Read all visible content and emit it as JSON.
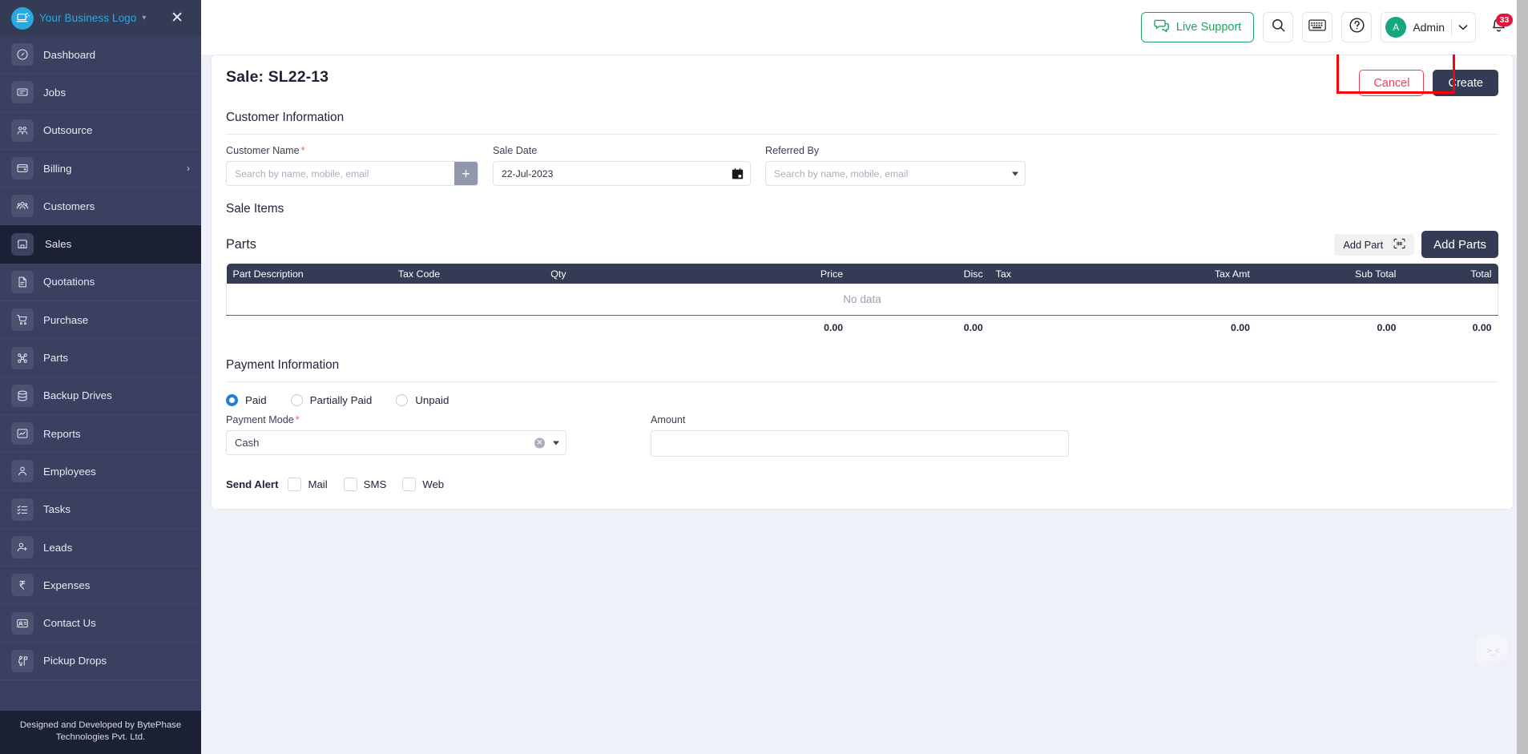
{
  "sidebar": {
    "logo_text": "Your Business Logo",
    "items": [
      {
        "label": "Dashboard",
        "icon": "dashboard-icon",
        "active": false,
        "arrow": ""
      },
      {
        "label": "Jobs",
        "icon": "jobs-icon",
        "active": false,
        "arrow": ""
      },
      {
        "label": "Outsource",
        "icon": "outsource-icon",
        "active": false,
        "arrow": ""
      },
      {
        "label": "Billing",
        "icon": "billing-icon",
        "active": false,
        "arrow": "›"
      },
      {
        "label": "Customers",
        "icon": "customers-icon",
        "active": false,
        "arrow": ""
      },
      {
        "label": "Sales",
        "icon": "sales-icon",
        "active": true,
        "arrow": ""
      },
      {
        "label": "Quotations",
        "icon": "quotations-icon",
        "active": false,
        "arrow": ""
      },
      {
        "label": "Purchase",
        "icon": "purchase-icon",
        "active": false,
        "arrow": ""
      },
      {
        "label": "Parts",
        "icon": "parts-icon",
        "active": false,
        "arrow": ""
      },
      {
        "label": "Backup Drives",
        "icon": "backup-drives-icon",
        "active": false,
        "arrow": ""
      },
      {
        "label": "Reports",
        "icon": "reports-icon",
        "active": false,
        "arrow": ""
      },
      {
        "label": "Employees",
        "icon": "employees-icon",
        "active": false,
        "arrow": ""
      },
      {
        "label": "Tasks",
        "icon": "tasks-icon",
        "active": false,
        "arrow": ""
      },
      {
        "label": "Leads",
        "icon": "leads-icon",
        "active": false,
        "arrow": ""
      },
      {
        "label": "Expenses",
        "icon": "expenses-icon",
        "active": false,
        "arrow": ""
      },
      {
        "label": "Contact Us",
        "icon": "contact-us-icon",
        "active": false,
        "arrow": ""
      },
      {
        "label": "Pickup Drops",
        "icon": "pickup-drops-icon",
        "active": false,
        "arrow": ""
      }
    ],
    "footer": "Designed and Developed by BytePhase Technologies Pvt. Ltd."
  },
  "topbar": {
    "live_support_label": "Live Support",
    "user_initial": "A",
    "user_name": "Admin",
    "notification_count": "33"
  },
  "page": {
    "title": "Sale: SL22-13",
    "cancel_label": "Cancel",
    "create_label": "Create"
  },
  "customer_information": {
    "section_title": "Customer Information",
    "customer_name_label": "Customer Name",
    "customer_name_placeholder": "Search by name, mobile, email",
    "customer_name_value": "",
    "add_customer_label": "+",
    "sale_date_label": "Sale Date",
    "sale_date_value": "22-Jul-2023",
    "referred_by_label": "Referred By",
    "referred_by_placeholder": "Search by name, mobile, email",
    "referred_by_value": ""
  },
  "sale_items": {
    "section_title": "Sale Items",
    "parts_title": "Parts",
    "add_part_tooltip": "Add Part",
    "add_parts_label": "Add Parts",
    "columns": [
      "Part Description",
      "Tax Code",
      "Qty",
      "Price",
      "Disc",
      "Tax",
      "Tax Amt",
      "Sub Total",
      "Total"
    ],
    "empty_text": "No data",
    "totals": {
      "price": "0.00",
      "disc": "0.00",
      "tax_amt": "0.00",
      "sub_total": "0.00",
      "total": "0.00"
    }
  },
  "payment_information": {
    "section_title": "Payment Information",
    "status_options": [
      {
        "label": "Paid",
        "selected": true
      },
      {
        "label": "Partially Paid",
        "selected": false
      },
      {
        "label": "Unpaid",
        "selected": false
      }
    ],
    "payment_mode_label": "Payment Mode",
    "payment_mode_value": "Cash",
    "amount_label": "Amount",
    "amount_value": ""
  },
  "send_alert": {
    "label": "Send Alert",
    "channels": [
      {
        "label": "Mail",
        "checked": false
      },
      {
        "label": "SMS",
        "checked": false
      },
      {
        "label": "Web",
        "checked": false
      }
    ]
  },
  "colors": {
    "sidebar_bg": "#3a4160",
    "sidebar_header_bg": "#343b55",
    "sidebar_active_bg": "#1c2034",
    "brand_cyan": "#2ea8e6",
    "primary_dark": "#343b55",
    "danger_red": "#ef3f56",
    "success_green": "#21a366",
    "badge_red": "#e8123c",
    "highlight_red": "#fb0006",
    "radio_blue": "#1f7fd0",
    "page_bg": "#eef1f7"
  }
}
